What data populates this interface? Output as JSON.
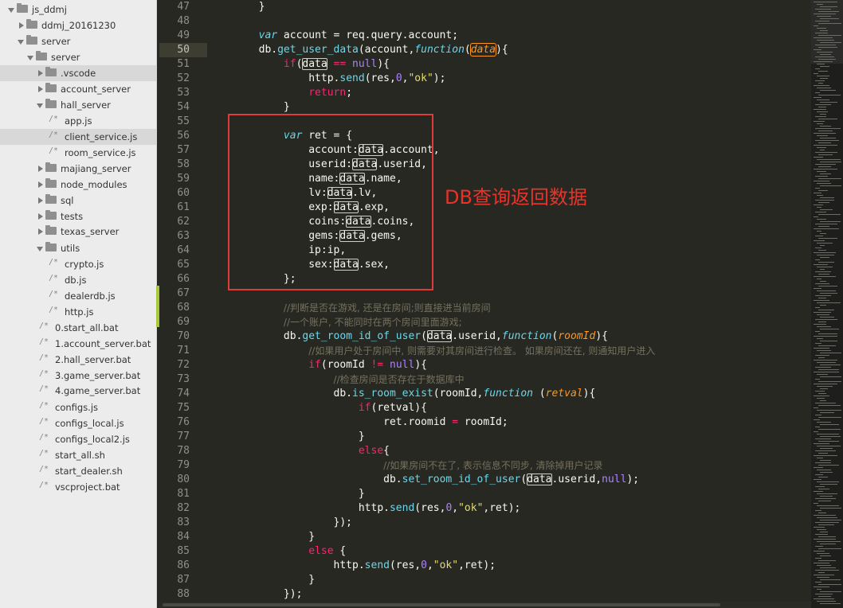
{
  "sidebar": {
    "items": [
      {
        "label": "js_ddmj",
        "kind": "folder",
        "open": true,
        "selected": false
      },
      {
        "label": "ddmj_20161230",
        "kind": "folder",
        "open": false,
        "selected": false
      },
      {
        "label": "server",
        "kind": "folder",
        "open": true,
        "selected": false
      },
      {
        "label": "server",
        "kind": "folder",
        "open": true,
        "selected": false
      },
      {
        "label": ".vscode",
        "kind": "folder",
        "open": false,
        "selected": true
      },
      {
        "label": "account_server",
        "kind": "folder",
        "open": false,
        "selected": false
      },
      {
        "label": "hall_server",
        "kind": "folder",
        "open": true,
        "selected": false
      },
      {
        "label": "app.js",
        "kind": "file",
        "selected": false
      },
      {
        "label": "client_service.js",
        "kind": "file",
        "selected": true
      },
      {
        "label": "room_service.js",
        "kind": "file",
        "selected": false
      },
      {
        "label": "majiang_server",
        "kind": "folder",
        "open": false,
        "selected": false
      },
      {
        "label": "node_modules",
        "kind": "folder",
        "open": false,
        "selected": false
      },
      {
        "label": "sql",
        "kind": "folder",
        "open": false,
        "selected": false
      },
      {
        "label": "tests",
        "kind": "folder",
        "open": false,
        "selected": false
      },
      {
        "label": "texas_server",
        "kind": "folder",
        "open": false,
        "selected": false
      },
      {
        "label": "utils",
        "kind": "folder",
        "open": true,
        "selected": false
      },
      {
        "label": "crypto.js",
        "kind": "file",
        "selected": false
      },
      {
        "label": "db.js",
        "kind": "file",
        "selected": false
      },
      {
        "label": "dealerdb.js",
        "kind": "file",
        "selected": false
      },
      {
        "label": "http.js",
        "kind": "file",
        "selected": false
      },
      {
        "label": "0.start_all.bat",
        "kind": "file",
        "selected": false
      },
      {
        "label": "1.account_server.bat",
        "kind": "file",
        "selected": false
      },
      {
        "label": "2.hall_server.bat",
        "kind": "file",
        "selected": false
      },
      {
        "label": "3.game_server.bat",
        "kind": "file",
        "selected": false
      },
      {
        "label": "4.game_server.bat",
        "kind": "file",
        "selected": false
      },
      {
        "label": "configs.js",
        "kind": "file",
        "selected": false
      },
      {
        "label": "configs_local.js",
        "kind": "file",
        "selected": false
      },
      {
        "label": "configs_local2.js",
        "kind": "file",
        "selected": false
      },
      {
        "label": "start_all.sh",
        "kind": "file",
        "selected": false
      },
      {
        "label": "start_dealer.sh",
        "kind": "file",
        "selected": false
      },
      {
        "label": "vscproject.bat",
        "kind": "file",
        "selected": false
      }
    ],
    "file_marker": "/*"
  },
  "editor": {
    "current_line": "50",
    "lines": [
      {
        "n": "47",
        "t": [
          [
            "        }",
            "p"
          ]
        ]
      },
      {
        "n": "48",
        "t": []
      },
      {
        "n": "49",
        "t": [
          [
            "        ",
            "p"
          ],
          [
            "var",
            "st"
          ],
          [
            " account = req.query.account;",
            "p"
          ]
        ]
      },
      {
        "n": "50",
        "t": [
          [
            "        db.",
            "p"
          ],
          [
            "get_user_data",
            "fn"
          ],
          [
            "(account,",
            "p"
          ],
          [
            "function",
            "st"
          ],
          [
            "(",
            "p"
          ],
          [
            "data",
            "boxhl"
          ],
          [
            "){",
            "p"
          ]
        ]
      },
      {
        "n": "51",
        "t": [
          [
            "            ",
            "p"
          ],
          [
            "if",
            "kw"
          ],
          [
            "(",
            "p"
          ],
          [
            "data",
            "box"
          ],
          [
            " ",
            "p"
          ],
          [
            "==",
            "kw"
          ],
          [
            " ",
            "p"
          ],
          [
            "null",
            "num"
          ],
          [
            "){",
            "p"
          ]
        ]
      },
      {
        "n": "52",
        "t": [
          [
            "                http.",
            "p"
          ],
          [
            "send",
            "fn"
          ],
          [
            "(res,",
            "p"
          ],
          [
            "0",
            "num"
          ],
          [
            ",",
            "p"
          ],
          [
            "\"ok\"",
            "str"
          ],
          [
            ");",
            "p"
          ]
        ]
      },
      {
        "n": "53",
        "t": [
          [
            "                ",
            "p"
          ],
          [
            "return",
            "kw"
          ],
          [
            ";",
            "p"
          ]
        ]
      },
      {
        "n": "54",
        "t": [
          [
            "            }",
            "p"
          ]
        ]
      },
      {
        "n": "55",
        "t": []
      },
      {
        "n": "56",
        "t": [
          [
            "            ",
            "p"
          ],
          [
            "var",
            "st"
          ],
          [
            " ret = {",
            "p"
          ]
        ]
      },
      {
        "n": "57",
        "t": [
          [
            "                account:",
            "p"
          ],
          [
            "data",
            "box"
          ],
          [
            ".account,",
            "p"
          ]
        ]
      },
      {
        "n": "58",
        "t": [
          [
            "                userid:",
            "p"
          ],
          [
            "data",
            "box"
          ],
          [
            ".userid,",
            "p"
          ]
        ]
      },
      {
        "n": "59",
        "t": [
          [
            "                name:",
            "p"
          ],
          [
            "data",
            "box"
          ],
          [
            ".name,",
            "p"
          ]
        ]
      },
      {
        "n": "60",
        "t": [
          [
            "                lv:",
            "p"
          ],
          [
            "data",
            "box"
          ],
          [
            ".lv,",
            "p"
          ]
        ]
      },
      {
        "n": "61",
        "t": [
          [
            "                exp:",
            "p"
          ],
          [
            "data",
            "box"
          ],
          [
            ".exp,",
            "p"
          ]
        ]
      },
      {
        "n": "62",
        "t": [
          [
            "                coins:",
            "p"
          ],
          [
            "data",
            "box"
          ],
          [
            ".coins,",
            "p"
          ]
        ]
      },
      {
        "n": "63",
        "t": [
          [
            "                gems:",
            "p"
          ],
          [
            "data",
            "box"
          ],
          [
            ".gems,",
            "p"
          ]
        ]
      },
      {
        "n": "64",
        "t": [
          [
            "                ip:ip,",
            "p"
          ]
        ]
      },
      {
        "n": "65",
        "t": [
          [
            "                sex:",
            "p"
          ],
          [
            "data",
            "box"
          ],
          [
            ".sex,",
            "p"
          ]
        ]
      },
      {
        "n": "66",
        "t": [
          [
            "            };",
            "p"
          ]
        ]
      },
      {
        "n": "67",
        "t": []
      },
      {
        "n": "68",
        "t": [
          [
            "            ",
            "p"
          ],
          [
            "//判断是否在游戏, 还是在房间;则直接进当前房间",
            "cmt"
          ]
        ]
      },
      {
        "n": "69",
        "t": [
          [
            "            ",
            "p"
          ],
          [
            "//一个账户, 不能同时在两个房间里面游戏;",
            "cmt"
          ]
        ]
      },
      {
        "n": "70",
        "t": [
          [
            "            db.",
            "p"
          ],
          [
            "get_room_id_of_user",
            "fn"
          ],
          [
            "(",
            "p"
          ],
          [
            "data",
            "box"
          ],
          [
            ".userid,",
            "p"
          ],
          [
            "function",
            "st"
          ],
          [
            "(",
            "p"
          ],
          [
            "roomId",
            "prm"
          ],
          [
            "){",
            "p"
          ]
        ]
      },
      {
        "n": "71",
        "t": [
          [
            "                ",
            "p"
          ],
          [
            "//如果用户处于房间中, 则需要对其房间进行检查。 如果房间还在, 则通知用户进入",
            "cmt"
          ]
        ]
      },
      {
        "n": "72",
        "t": [
          [
            "                ",
            "p"
          ],
          [
            "if",
            "kw"
          ],
          [
            "(roomId ",
            "p"
          ],
          [
            "!=",
            "kw"
          ],
          [
            " ",
            "p"
          ],
          [
            "null",
            "num"
          ],
          [
            "){",
            "p"
          ]
        ]
      },
      {
        "n": "73",
        "t": [
          [
            "                    ",
            "p"
          ],
          [
            "//检查房间是否存在于数据库中",
            "cmt"
          ]
        ]
      },
      {
        "n": "74",
        "t": [
          [
            "                    db.",
            "p"
          ],
          [
            "is_room_exist",
            "fn"
          ],
          [
            "(roomId,",
            "p"
          ],
          [
            "function",
            "st"
          ],
          [
            " (",
            "p"
          ],
          [
            "retval",
            "prm"
          ],
          [
            "){",
            "p"
          ]
        ]
      },
      {
        "n": "75",
        "t": [
          [
            "                        ",
            "p"
          ],
          [
            "if",
            "kw"
          ],
          [
            "(retval){",
            "p"
          ]
        ]
      },
      {
        "n": "76",
        "t": [
          [
            "                            ret.roomid ",
            "p"
          ],
          [
            "=",
            "kw"
          ],
          [
            " roomId;",
            "p"
          ]
        ]
      },
      {
        "n": "77",
        "t": [
          [
            "                        }",
            "p"
          ]
        ]
      },
      {
        "n": "78",
        "t": [
          [
            "                        ",
            "p"
          ],
          [
            "else",
            "kw"
          ],
          [
            "{",
            "p"
          ]
        ]
      },
      {
        "n": "79",
        "t": [
          [
            "                            ",
            "p"
          ],
          [
            "//如果房间不在了, 表示信息不同步, 清除掉用户记录",
            "cmt"
          ]
        ]
      },
      {
        "n": "80",
        "t": [
          [
            "                            db.",
            "p"
          ],
          [
            "set_room_id_of_user",
            "fn"
          ],
          [
            "(",
            "p"
          ],
          [
            "data",
            "box"
          ],
          [
            ".userid,",
            "p"
          ],
          [
            "null",
            "num"
          ],
          [
            ");",
            "p"
          ]
        ]
      },
      {
        "n": "81",
        "t": [
          [
            "                        }",
            "p"
          ]
        ]
      },
      {
        "n": "82",
        "t": [
          [
            "                        http.",
            "p"
          ],
          [
            "send",
            "fn"
          ],
          [
            "(res,",
            "p"
          ],
          [
            "0",
            "num"
          ],
          [
            ",",
            "p"
          ],
          [
            "\"ok\"",
            "str"
          ],
          [
            ",ret);",
            "p"
          ]
        ]
      },
      {
        "n": "83",
        "t": [
          [
            "                    });",
            "p"
          ]
        ]
      },
      {
        "n": "84",
        "t": [
          [
            "                }",
            "p"
          ]
        ]
      },
      {
        "n": "85",
        "t": [
          [
            "                ",
            "p"
          ],
          [
            "else",
            "kw"
          ],
          [
            " {",
            "p"
          ]
        ]
      },
      {
        "n": "86",
        "t": [
          [
            "                    http.",
            "p"
          ],
          [
            "send",
            "fn"
          ],
          [
            "(res,",
            "p"
          ],
          [
            "0",
            "num"
          ],
          [
            ",",
            "p"
          ],
          [
            "\"ok\"",
            "str"
          ],
          [
            ",ret);",
            "p"
          ]
        ]
      },
      {
        "n": "87",
        "t": [
          [
            "                }",
            "p"
          ]
        ]
      },
      {
        "n": "88",
        "t": [
          [
            "            });",
            "p"
          ]
        ]
      }
    ]
  },
  "annotation": {
    "text": "DB查询返回数据",
    "color": "#e8332a"
  },
  "colors": {
    "keyword": "#f92672",
    "storage": "#66d9ef",
    "number": "#ae81ff",
    "string": "#e6db74",
    "comment": "#75715e",
    "param": "#fd971f",
    "background": "#272822"
  }
}
